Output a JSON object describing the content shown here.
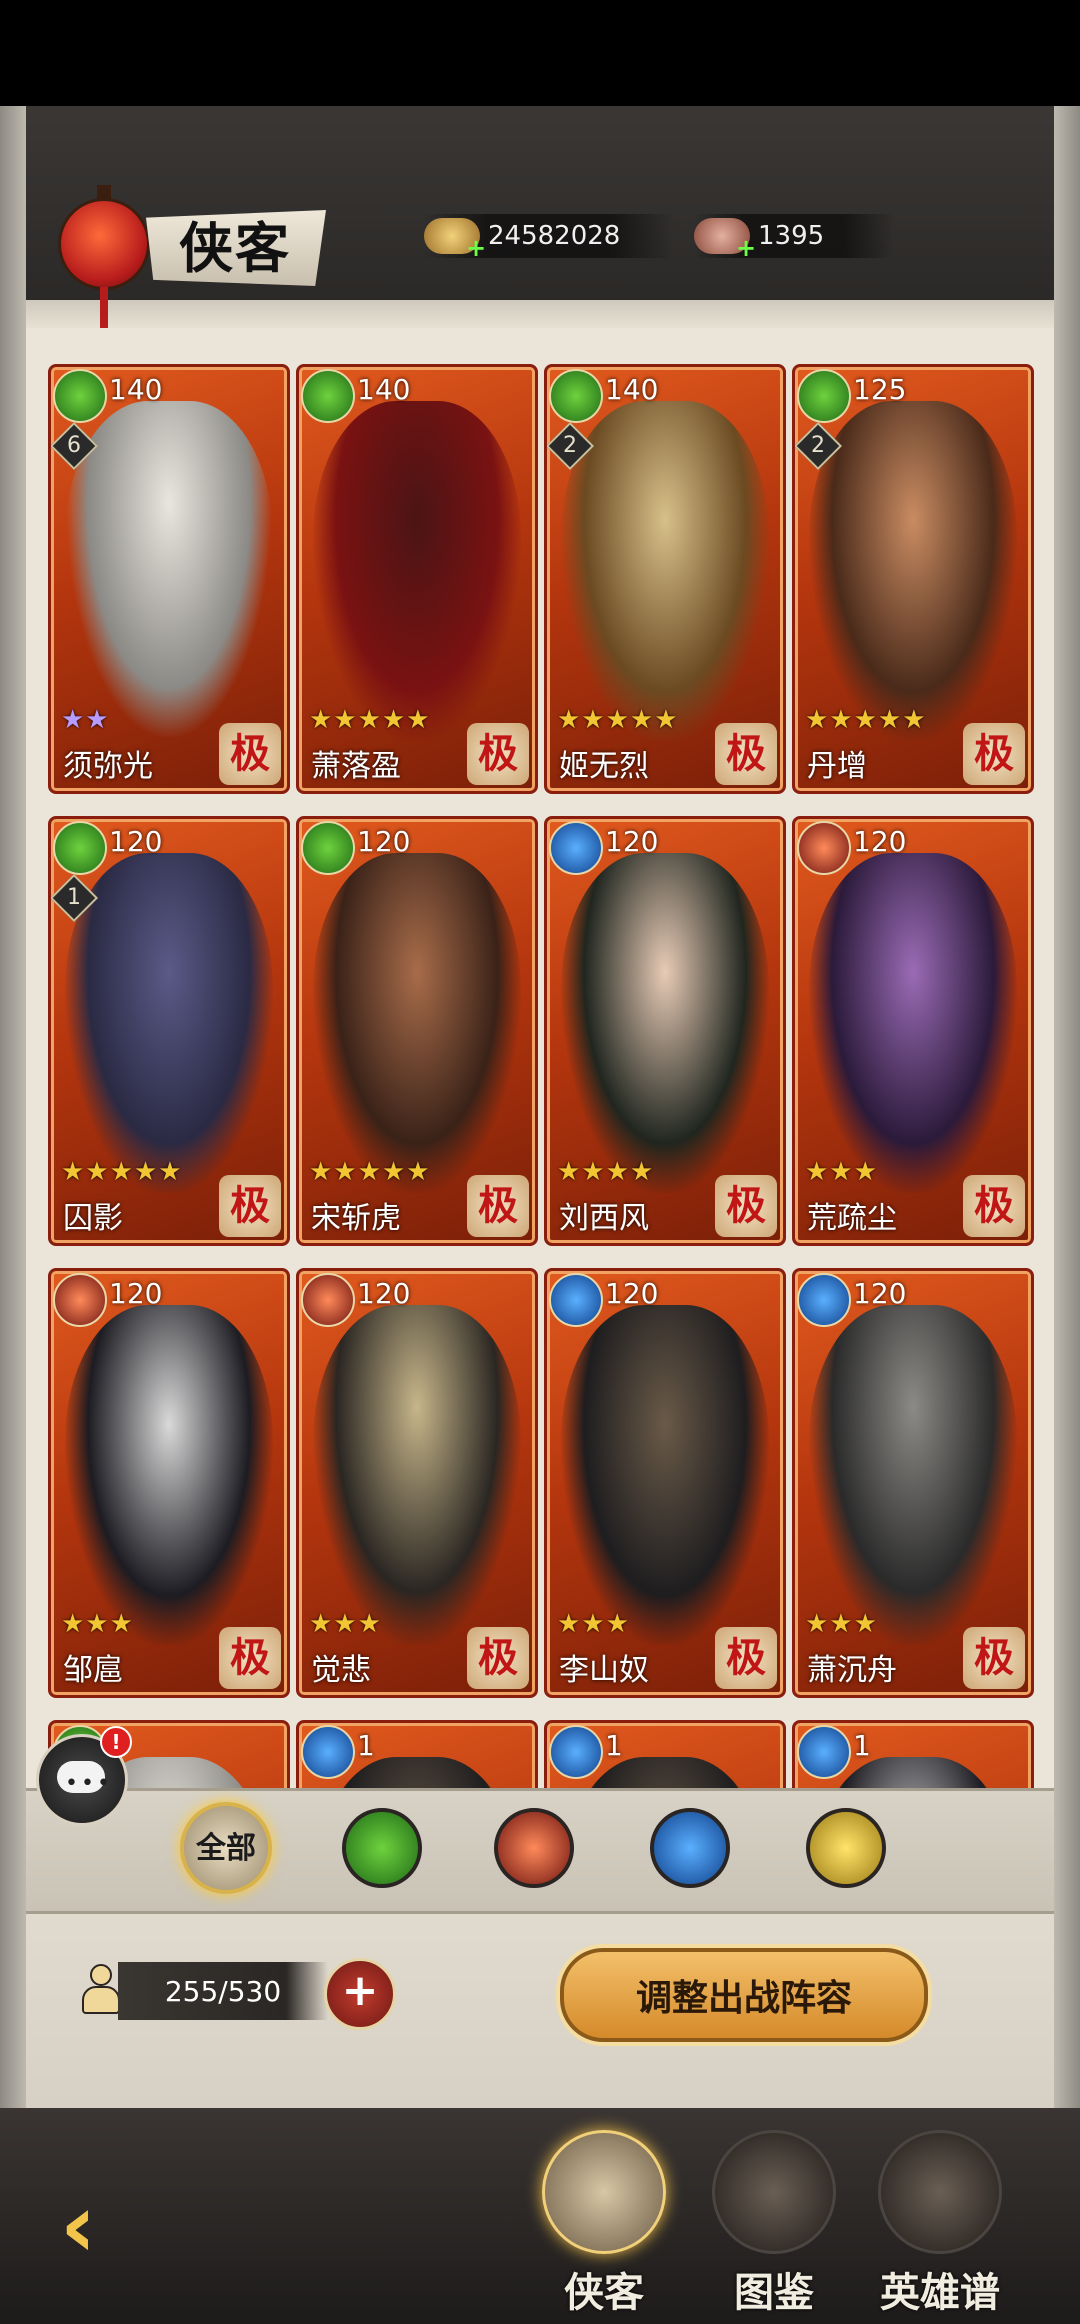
{
  "header": {
    "title": "侠客",
    "currencies": [
      {
        "icon": "gold-ingot-icon",
        "value": "24582028"
      },
      {
        "icon": "tea-cake-icon",
        "value": "1395"
      }
    ]
  },
  "heroes": [
    {
      "name": "须弥光",
      "level": "140",
      "element": "green",
      "rank": "6",
      "stars": "★★",
      "star_color": "purple",
      "grade": "极"
    },
    {
      "name": "萧落盈",
      "level": "140",
      "element": "green",
      "rank": "",
      "stars": "★★★★★",
      "star_color": "gold",
      "grade": "极"
    },
    {
      "name": "姬无烈",
      "level": "140",
      "element": "green",
      "rank": "2",
      "stars": "★★★★★",
      "star_color": "gold",
      "grade": "极"
    },
    {
      "name": "丹增",
      "level": "125",
      "element": "green",
      "rank": "2",
      "stars": "★★★★★",
      "star_color": "gold",
      "grade": "极"
    },
    {
      "name": "囚影",
      "level": "120",
      "element": "green",
      "rank": "1",
      "stars": "★★★★★",
      "star_color": "gold",
      "grade": "极"
    },
    {
      "name": "宋斩虎",
      "level": "120",
      "element": "green",
      "rank": "",
      "stars": "★★★★★",
      "star_color": "gold",
      "grade": "极"
    },
    {
      "name": "刘西风",
      "level": "120",
      "element": "blue",
      "rank": "",
      "stars": "★★★★",
      "star_color": "gold",
      "grade": "极"
    },
    {
      "name": "荒疏尘",
      "level": "120",
      "element": "red",
      "rank": "",
      "stars": "★★★",
      "star_color": "gold",
      "grade": "极"
    },
    {
      "name": "邹扈",
      "level": "120",
      "element": "red",
      "rank": "",
      "stars": "★★★",
      "star_color": "gold",
      "grade": "极"
    },
    {
      "name": "觉悲",
      "level": "120",
      "element": "red",
      "rank": "",
      "stars": "★★★",
      "star_color": "gold",
      "grade": "极"
    },
    {
      "name": "李山奴",
      "level": "120",
      "element": "blue",
      "rank": "",
      "stars": "★★★",
      "star_color": "gold",
      "grade": "极"
    },
    {
      "name": "萧沉舟",
      "level": "120",
      "element": "blue",
      "rank": "",
      "stars": "★★★",
      "star_color": "gold",
      "grade": "极"
    }
  ],
  "partial_row": [
    {
      "element": "green",
      "level": ""
    },
    {
      "element": "blue",
      "level": "1"
    },
    {
      "element": "blue",
      "level": "1"
    },
    {
      "element": "blue",
      "level": "1"
    }
  ],
  "chat": {
    "badge": "!"
  },
  "filters": [
    {
      "label": "全部",
      "icon": "all-filter-icon",
      "active": true
    },
    {
      "label": "",
      "icon": "green-element-icon",
      "active": false
    },
    {
      "label": "",
      "icon": "red-element-icon",
      "active": false
    },
    {
      "label": "",
      "icon": "blue-element-icon",
      "active": false
    },
    {
      "label": "",
      "icon": "gold-dragon-element-icon",
      "active": false
    }
  ],
  "roster": {
    "count": "255/530",
    "plus_label": "+"
  },
  "lineup_button": "调整出战阵容",
  "nav": {
    "back_label": "‹",
    "tabs": [
      {
        "label": "侠客",
        "active": true
      },
      {
        "label": "图鉴",
        "active": false
      },
      {
        "label": "英雄谱",
        "active": false
      }
    ]
  }
}
